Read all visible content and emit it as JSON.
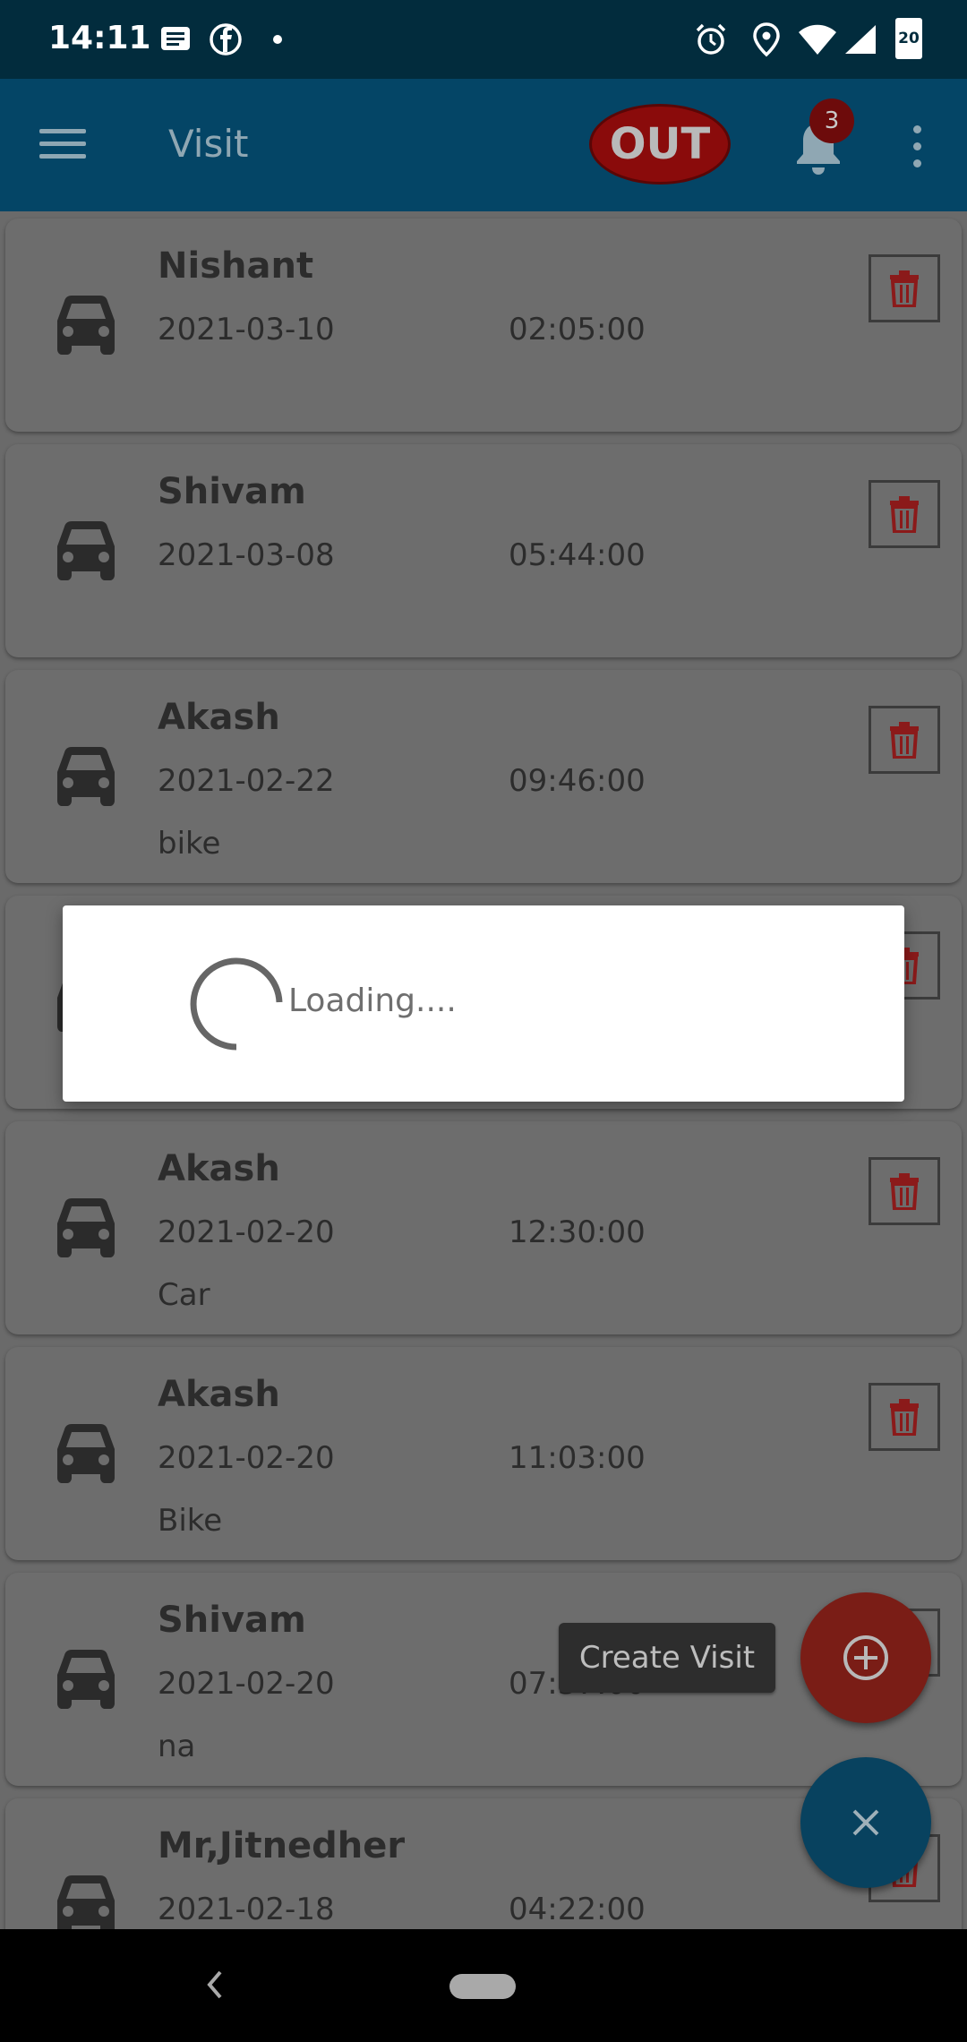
{
  "status_bar": {
    "time": "14:11",
    "battery": "20",
    "icons": [
      "message-icon",
      "facebook-icon",
      "dot-icon",
      "alarm-icon",
      "location-icon",
      "wifi-icon",
      "signal-icon",
      "battery-icon"
    ]
  },
  "app_bar": {
    "title": "Visit",
    "out_label": "OUT",
    "notification_count": "3"
  },
  "visits": [
    {
      "name": "Nishant",
      "date": "2021-03-10",
      "time": "02:05:00",
      "note": ""
    },
    {
      "name": "Shivam",
      "date": "2021-03-08",
      "time": "05:44:00",
      "note": ""
    },
    {
      "name": "Akash",
      "date": "2021-02-22",
      "time": "09:46:00",
      "note": "bike"
    },
    {
      "name": "",
      "date": "",
      "time": "",
      "note": ""
    },
    {
      "name": "Akash",
      "date": "2021-02-20",
      "time": "12:30:00",
      "note": "Car"
    },
    {
      "name": "Akash",
      "date": "2021-02-20",
      "time": "11:03:00",
      "note": "Bike"
    },
    {
      "name": "Shivam",
      "date": "2021-02-20",
      "time": "07:37:00",
      "note": "na"
    },
    {
      "name": "Mr,Jitnedher",
      "date": "2021-02-18",
      "time": "04:22:00",
      "note": ""
    }
  ],
  "fab": {
    "create_label": "Create Visit"
  },
  "dialog": {
    "message": "Loading...."
  },
  "colors": {
    "app_bar": "#044566",
    "status_bar": "#022c3d",
    "out_button": "#8a0b0b",
    "fab_red": "#7a1d16",
    "fab_blue": "#08425f",
    "trash": "#8b1a1a"
  }
}
